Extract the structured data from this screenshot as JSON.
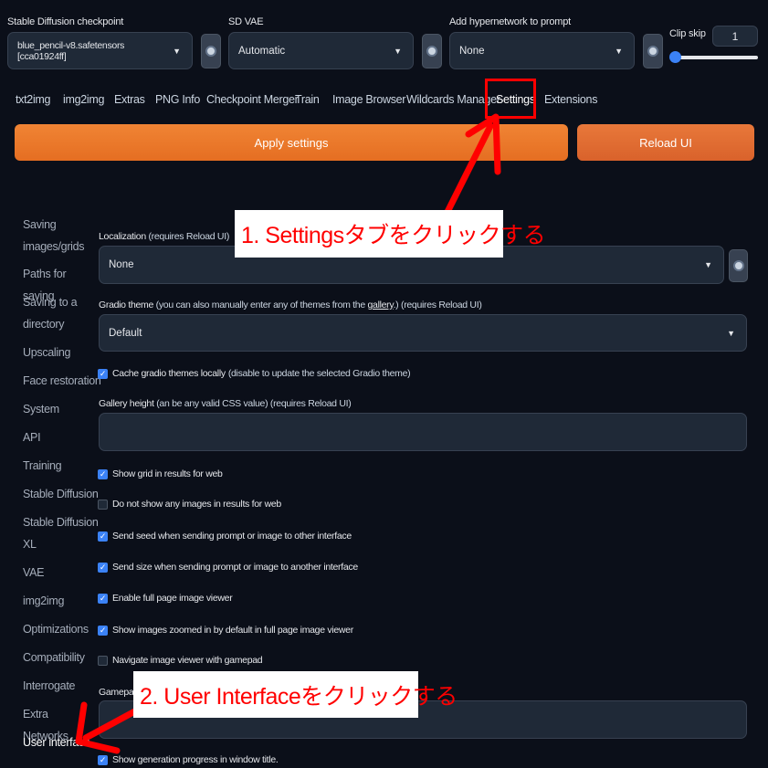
{
  "header": {
    "checkpoint": {
      "label": "Stable Diffusion checkpoint",
      "value": "blue_pencil-v8.safetensors [cca01924ff]"
    },
    "vae": {
      "label": "SD VAE",
      "value": "Automatic"
    },
    "hypernetwork": {
      "label": "Add hypernetwork to prompt",
      "value": "None"
    },
    "clip_skip": {
      "label": "Clip skip",
      "value": "1"
    }
  },
  "tabs": [
    "txt2img",
    "img2img",
    "Extras",
    "PNG Info",
    "Checkpoint Merger",
    "Train",
    "Image Browser",
    "Wildcards Manager",
    "Settings",
    "Extensions"
  ],
  "active_tab": "Settings",
  "buttons": {
    "apply": "Apply settings",
    "reload": "Reload UI"
  },
  "sidebar": [
    "Saving images/grids",
    "Paths for saving",
    "Saving to a directory",
    "Upscaling",
    "Face restoration",
    "System",
    "API",
    "Training",
    "Stable Diffusion",
    "Stable Diffusion XL",
    "VAE",
    "img2img",
    "Optimizations",
    "Compatibility",
    "Interrogate",
    "Extra Networks",
    "User interface"
  ],
  "active_sidebar": "User interface",
  "settings": {
    "localization": {
      "label": "Localization",
      "note": "(requires Reload UI)",
      "value": "None"
    },
    "gradio_theme": {
      "label": "Gradio theme",
      "note_pre": "(you can also manually enter any of themes from the ",
      "link": "gallery",
      "note_post": ".) (requires Reload UI)",
      "value": "Default"
    },
    "cache_themes": {
      "label": "Cache gradio themes locally",
      "note": "(disable to update the selected Gradio theme)",
      "checked": true
    },
    "gallery_height": {
      "label": "Gallery height",
      "note": "(an be any valid CSS value) (requires Reload UI)",
      "value": ""
    },
    "checkboxes": [
      {
        "label": "Show grid in results for web",
        "checked": true
      },
      {
        "label": "Do not show any images in results for web",
        "checked": false
      },
      {
        "label": "Send seed when sending prompt or image to other interface",
        "checked": true
      },
      {
        "label": "Send size when sending prompt or image to another interface",
        "checked": true
      },
      {
        "label": "Enable full page image viewer",
        "checked": true
      },
      {
        "label": "Show images zoomed in by default in full page image viewer",
        "checked": true
      },
      {
        "label": "Navigate image viewer with gamepad",
        "checked": false
      }
    ],
    "gamepad_label": "Gamepad",
    "progress_title": {
      "label": "Show generation progress in window title.",
      "checked": true
    }
  },
  "annotations": {
    "step1": "1. Settingsタブをクリックする",
    "step2": "2. User Interfaceをクリックする",
    "color": "#ff0000"
  },
  "colors": {
    "background": "#0b0f19",
    "accent_orange": "#e8783a",
    "checkbox_blue": "#3b82f6"
  }
}
